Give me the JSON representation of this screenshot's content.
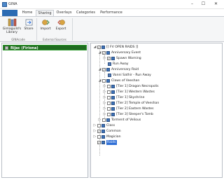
{
  "window": {
    "title": "GINA"
  },
  "menu": {
    "file_label": ""
  },
  "ribbon_tabs": [
    "Home",
    "Sharing",
    "Overlays",
    "Categories",
    "Performance"
  ],
  "ribbon": {
    "buttons": {
      "library": "Gimaguild's Library",
      "share": "Share",
      "import": "Import",
      "export": "Export"
    },
    "groups": {
      "group1": "GINAcode",
      "group2": "External Sources"
    }
  },
  "left_pane": {
    "character": "Rijac (Firiona)"
  },
  "tree": {
    "items": [
      "[[ FV OPEN RAIDS ]]",
      "Anniversary Event",
      "Spawn Warning",
      "Run Away",
      "Anniversary Raid",
      "Vanni Sathir - Run Away",
      "Claws of Veeshan",
      "[Tier 1] Dragon Necropolis",
      "[Tier 1] Western Wastes",
      "[Tier 1] Skyshrine",
      "[Tier 2] Temple of Veeshan",
      "[Tier 2] Eastern Wastes",
      "[Tier 3] Sleeper's Tomb",
      "Torment of Velious",
      "Class",
      "Common",
      "Magician",
      "Raids"
    ]
  }
}
